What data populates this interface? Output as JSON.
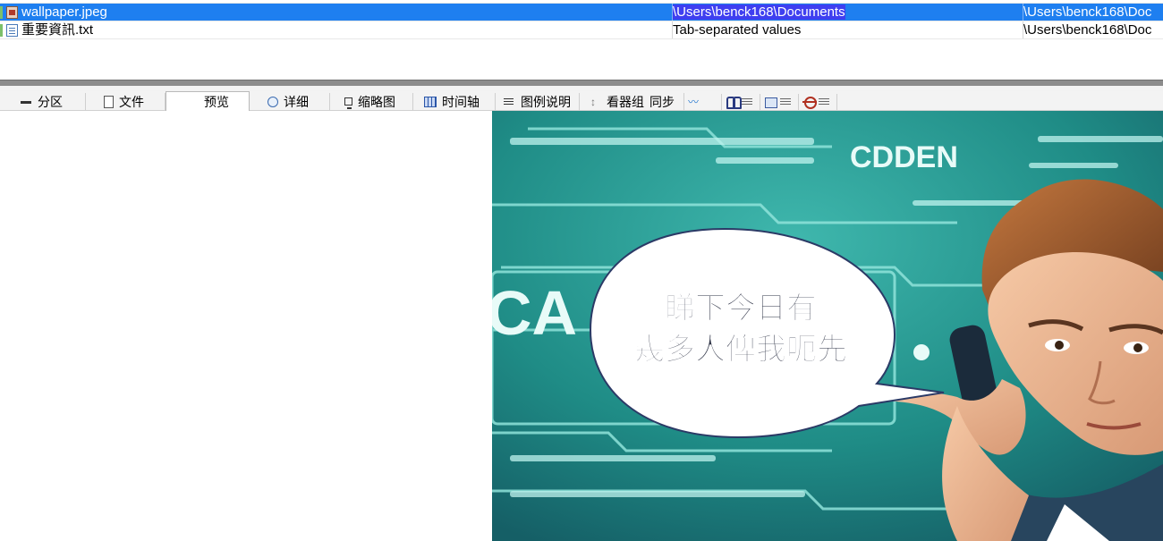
{
  "file_list": {
    "rows": [
      {
        "name": "wallpaper.jpeg",
        "type": "\\Users\\benck168\\Documents",
        "path": "\\Users\\benck168\\Doc",
        "icon": "image-file-icon",
        "selected": true
      },
      {
        "name": "重要資訊.txt",
        "type": "Tab-separated values",
        "path": "\\Users\\benck168\\Doc",
        "icon": "text-file-icon",
        "selected": false
      }
    ]
  },
  "tabs": [
    {
      "label": "分区",
      "icon": "partition-icon"
    },
    {
      "label": "文件",
      "icon": "file-icon"
    },
    {
      "label": "预览",
      "icon": "preview-icon",
      "active": true
    },
    {
      "label": "详细",
      "icon": "detail-icon"
    },
    {
      "label": "缩略图",
      "icon": "thumbnail-icon"
    },
    {
      "label": "时间轴",
      "icon": "timeline-icon"
    },
    {
      "label": "图例说明",
      "icon": "legend-icon"
    },
    {
      "label": "看器组",
      "icon": "viewer-group-icon"
    },
    {
      "label": "同步",
      "icon": "sync-icon"
    }
  ],
  "preview": {
    "image_caption_line1": "睇下今日有",
    "image_caption_line2": "幾多人俾我呃先",
    "image_text_top": "CDDEN",
    "image_text_left": "CA",
    "colors": {
      "bg": "#1f8c86",
      "bubble": "#ffffff",
      "caption": "#2e3346",
      "hair": "#8a4a25",
      "jacket": "#28455e"
    }
  },
  "colors": {
    "selection": "#1e7ff0",
    "selection_text_bg": "#3f3ff0",
    "splitter": "#8c8c8c"
  }
}
